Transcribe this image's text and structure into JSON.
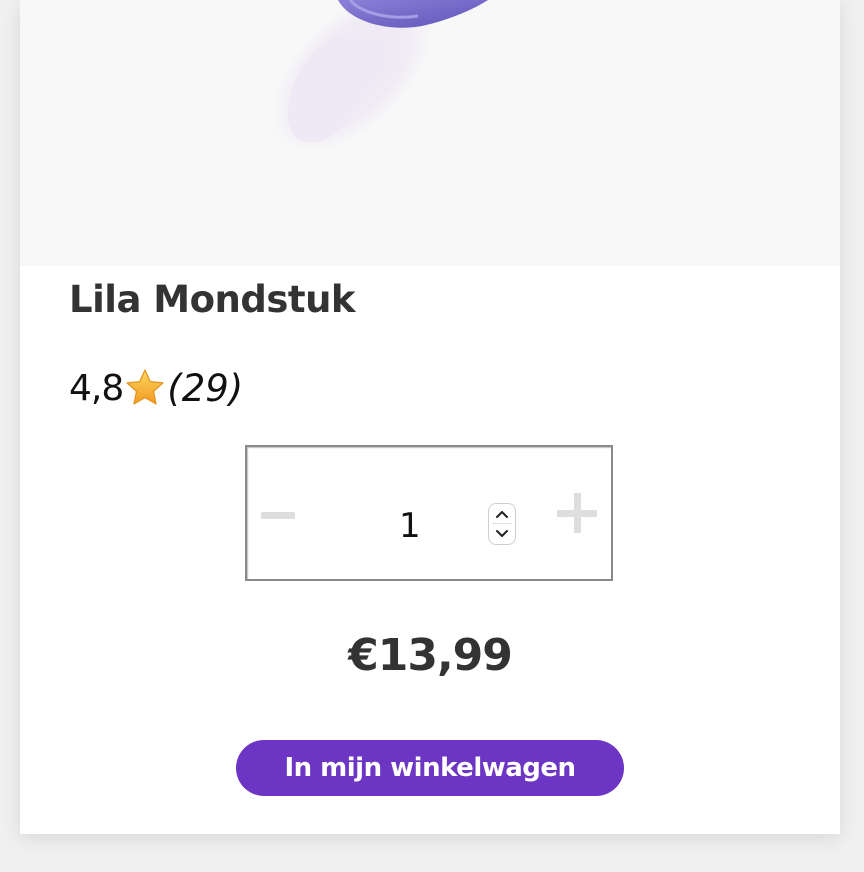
{
  "product": {
    "title": "Lila Mondstuk",
    "image_icon": "purple-mouthpiece-image"
  },
  "rating": {
    "value": "4,8",
    "count": "(29)",
    "icon": "star-icon"
  },
  "quantity": {
    "value": "1",
    "minus_icon": "minus-icon",
    "plus_icon": "plus-icon"
  },
  "price": "€13,99",
  "cart_button": {
    "label": "In mijn winkelwagen"
  },
  "colors": {
    "accent": "#6d35c4",
    "title": "#333333",
    "star": "#f5b638"
  }
}
